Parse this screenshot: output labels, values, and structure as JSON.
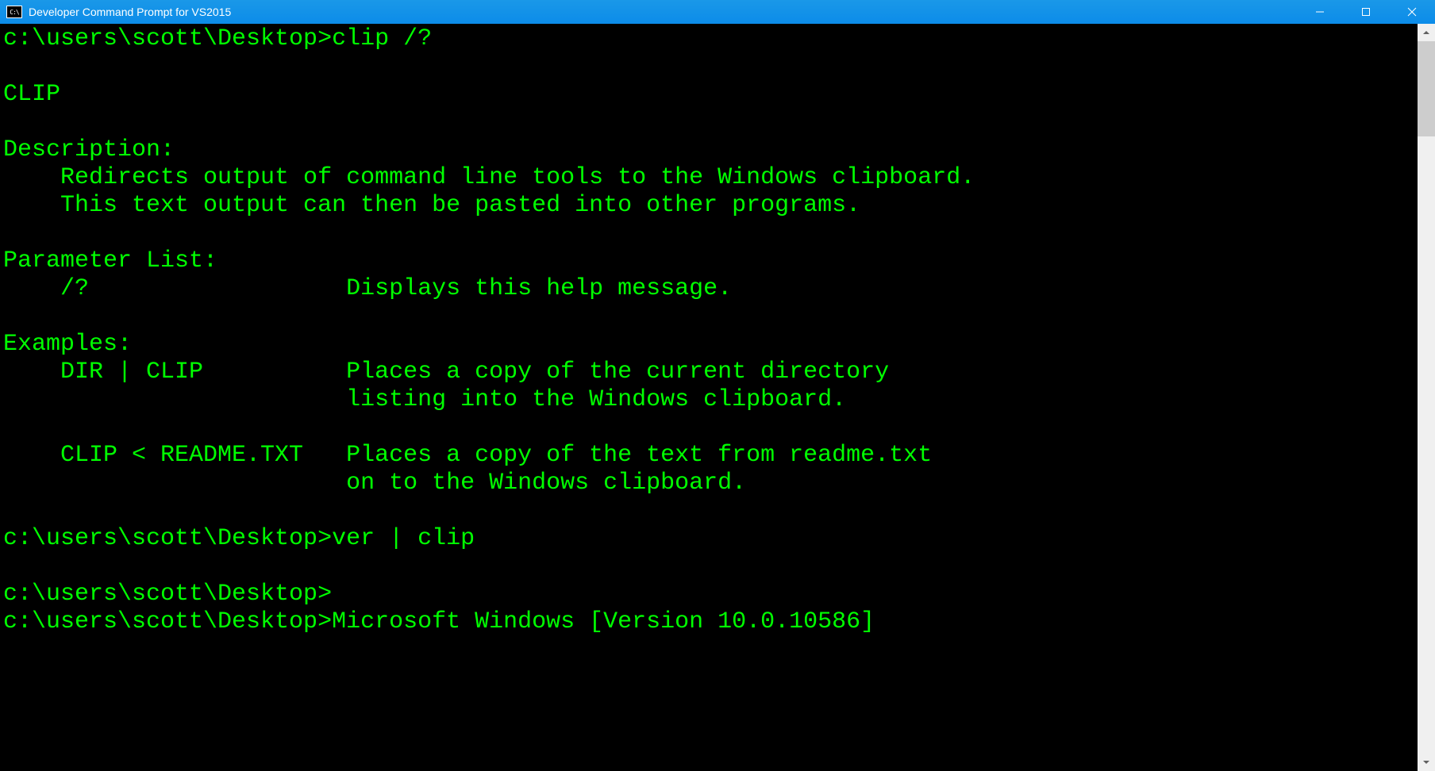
{
  "window": {
    "title": "Developer Command Prompt for VS2015",
    "icon_label": "C:\\"
  },
  "terminal": {
    "lines": [
      {
        "prompt": "c:\\users\\scott\\Desktop>",
        "text": "clip /?"
      },
      {
        "prompt": "",
        "text": ""
      },
      {
        "prompt": "",
        "text": "CLIP"
      },
      {
        "prompt": "",
        "text": ""
      },
      {
        "prompt": "",
        "text": "Description:"
      },
      {
        "prompt": "",
        "text": "    Redirects output of command line tools to the Windows clipboard."
      },
      {
        "prompt": "",
        "text": "    This text output can then be pasted into other programs."
      },
      {
        "prompt": "",
        "text": ""
      },
      {
        "prompt": "",
        "text": "Parameter List:"
      },
      {
        "prompt": "",
        "text": "    /?                  Displays this help message."
      },
      {
        "prompt": "",
        "text": ""
      },
      {
        "prompt": "",
        "text": "Examples:"
      },
      {
        "prompt": "",
        "text": "    DIR | CLIP          Places a copy of the current directory"
      },
      {
        "prompt": "",
        "text": "                        listing into the Windows clipboard."
      },
      {
        "prompt": "",
        "text": ""
      },
      {
        "prompt": "",
        "text": "    CLIP < README.TXT   Places a copy of the text from readme.txt"
      },
      {
        "prompt": "",
        "text": "                        on to the Windows clipboard."
      },
      {
        "prompt": "",
        "text": ""
      },
      {
        "prompt": "c:\\users\\scott\\Desktop>",
        "text": "ver | clip"
      },
      {
        "prompt": "",
        "text": ""
      },
      {
        "prompt": "c:\\users\\scott\\Desktop>",
        "text": ""
      },
      {
        "prompt": "c:\\users\\scott\\Desktop>",
        "text": "Microsoft Windows [Version 10.0.10586]"
      }
    ]
  }
}
